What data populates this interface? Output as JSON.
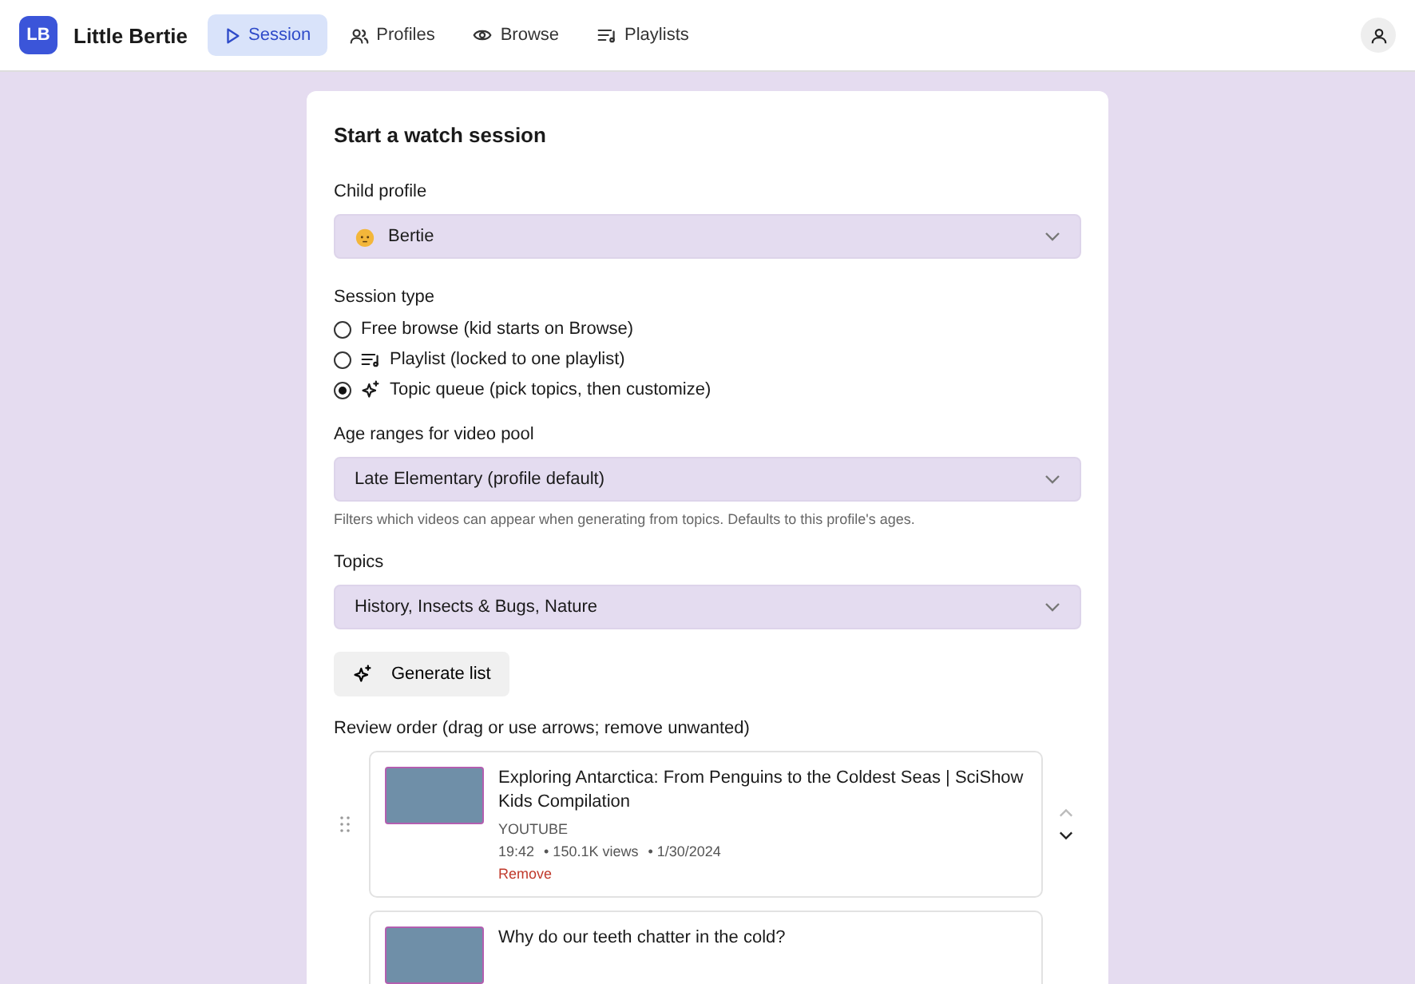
{
  "app": {
    "logo": "LB",
    "name": "Little Bertie"
  },
  "nav": [
    {
      "label": "Session",
      "selected": true
    },
    {
      "label": "Profiles",
      "selected": false
    },
    {
      "label": "Browse",
      "selected": false
    },
    {
      "label": "Playlists",
      "selected": false
    }
  ],
  "form": {
    "title": "Start a watch session",
    "child_profile": {
      "label": "Child profile",
      "value": "Bertie"
    },
    "session_type": {
      "label": "Session type",
      "options": [
        {
          "label": "Free browse (kid starts on Browse)",
          "selected": false
        },
        {
          "label": "Playlist (locked to one playlist)",
          "selected": false
        },
        {
          "label": "Topic queue (pick topics, then customize)",
          "selected": true
        }
      ]
    },
    "age_ranges": {
      "label": "Age ranges for video pool",
      "value": "Late Elementary (profile default)",
      "hint": "Filters which videos can appear when generating from topics. Defaults to this profile's ages."
    },
    "topics": {
      "label": "Topics",
      "value": "History, Insects & Bugs, Nature"
    },
    "generate_button": "Generate list",
    "review": {
      "label": "Review order (drag or use arrows; remove unwanted)",
      "items": [
        {
          "title": "Exploring Antarctica: From Penguins to the Coldest Seas | SciShow Kids Compilation",
          "source": "YOUTUBE",
          "duration": "19:42",
          "views": "• 150.1K views",
          "date": "• 1/30/2024",
          "remove": "Remove",
          "up_disabled": true,
          "down_disabled": false
        },
        {
          "title": "Why do our teeth chatter in the cold?"
        }
      ]
    }
  }
}
